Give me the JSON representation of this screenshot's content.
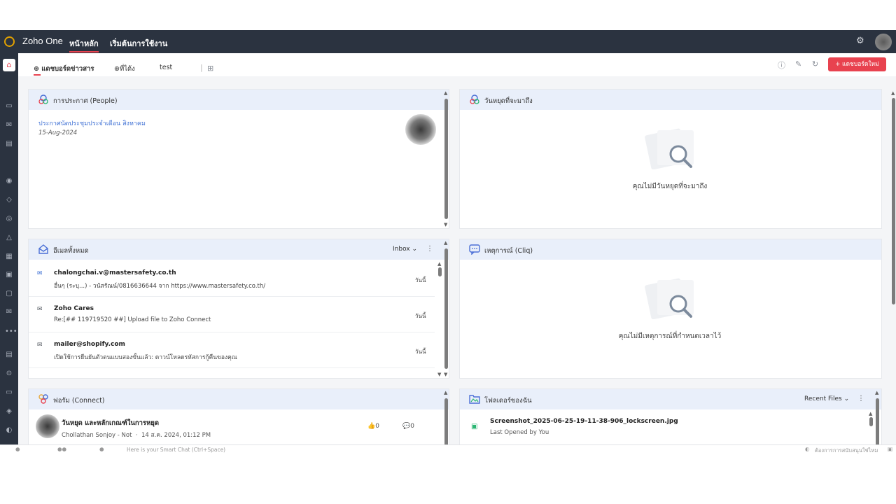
{
  "topbar": {
    "brand": "Zoho One",
    "nav": [
      "หน้าหลัก",
      "เริ่มต้นการใช้งาน"
    ]
  },
  "tabs": [
    "แดชบอร์ดข่าวสาร",
    "ที่ได้ง",
    "test"
  ],
  "header": {
    "new_button": "+ แดชบอร์ดใหม่"
  },
  "announcements": {
    "title": "การประกาศ (People)",
    "item_title": "ประกาศนัดประชุมประจำเดือน สิงหาคม",
    "item_date": "15-Aug-2024"
  },
  "holidays": {
    "title": "วันหยุดที่จะมาถึง",
    "empty": "คุณไม่มีวันหยุดที่จะมาถึง"
  },
  "mail": {
    "title": "อีเมลทั้งหมด",
    "folder": "Inbox",
    "items": [
      {
        "from": "chalongchai.v@mastersafety.co.th",
        "subject": "อื่นๆ (ระบุ...) - วนัสรัณน์/0816636644 จาก https://www.mastersafety.co.th/",
        "date": "วันนี้"
      },
      {
        "from": "Zoho Cares",
        "subject": "Re:[## 119719520 ##] Upload file to Zoho Connect",
        "date": "วันนี้"
      },
      {
        "from": "mailer@shopify.com",
        "subject": "เปิดใช้การยืนยันตัวตนแบบสองขั้นแล้ว: ดาวน์โหลดรหัสการกู้คืนของคุณ",
        "date": "วันนี้"
      }
    ]
  },
  "events": {
    "title": "เหตุการณ์ (Cliq)",
    "empty": "คุณไม่มีเหตุการณ์ที่กำหนดเวลาไว้"
  },
  "forum": {
    "title": "ฟอรัม (Connect)",
    "post_title": "วันหยุด และหลักเกณฑ์ในการหยุด",
    "author": "Chollathan Sonjoy - Not",
    "date": "14 ส.ค. 2024, 01:12 PM",
    "likes": "0",
    "comments": "0"
  },
  "files": {
    "title": "โฟลเดอร์ของฉัน",
    "filter": "Recent Files",
    "file_name": "Screenshot_2025-06-25-19-11-38-906_lockscreen.jpg",
    "file_meta": "Last Opened by You"
  },
  "bottombar": {
    "smart_chat": "Here is your Smart Chat (Ctrl+Space)",
    "support": "ต้องการการสนับสนุนใช่ไหม"
  }
}
